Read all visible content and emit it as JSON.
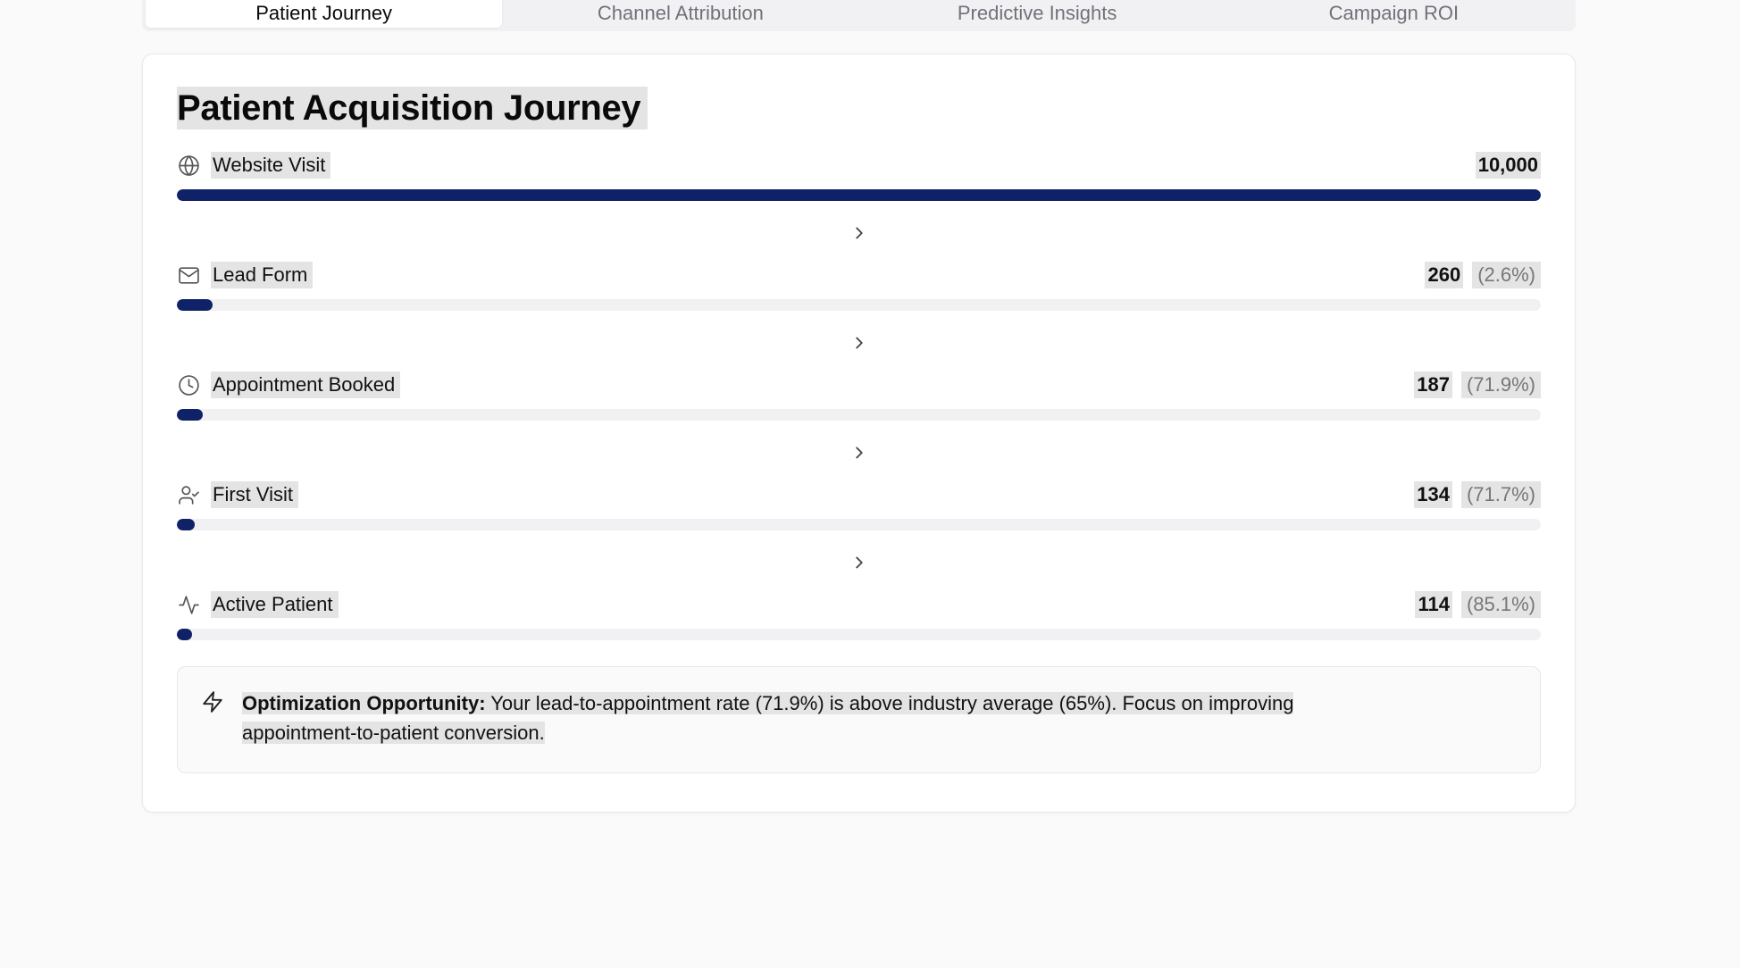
{
  "tabs": [
    {
      "label": "Patient Journey",
      "active": true
    },
    {
      "label": "Channel Attribution",
      "active": false
    },
    {
      "label": "Predictive Insights",
      "active": false
    },
    {
      "label": "Campaign ROI",
      "active": false
    }
  ],
  "card": {
    "title": "Patient Acquisition Journey"
  },
  "stages": [
    {
      "label": "Website Visit",
      "count": "10,000",
      "pct": "",
      "icon": "globe-icon",
      "fill": 1.0
    },
    {
      "label": "Lead Form",
      "count": "260",
      "pct": "(2.6%)",
      "icon": "mail-icon",
      "fill": 0.026
    },
    {
      "label": "Appointment Booked",
      "count": "187",
      "pct": "(71.9%)",
      "icon": "clock-icon",
      "fill": 0.0187
    },
    {
      "label": "First Visit",
      "count": "134",
      "pct": "(71.7%)",
      "icon": "user-check-icon",
      "fill": 0.0134
    },
    {
      "label": "Active Patient",
      "count": "114",
      "pct": "(85.1%)",
      "icon": "activity-icon",
      "fill": 0.0114
    }
  ],
  "insight": {
    "lead": "Optimization Opportunity:",
    "body": " Your lead-to-appointment rate (71.9%) is above industry average (65%). Focus on improving appointment-to-patient conversion.",
    "icon": "zap-icon"
  },
  "colors": {
    "bar": "#0f2167",
    "track": "#f1f1f3"
  }
}
